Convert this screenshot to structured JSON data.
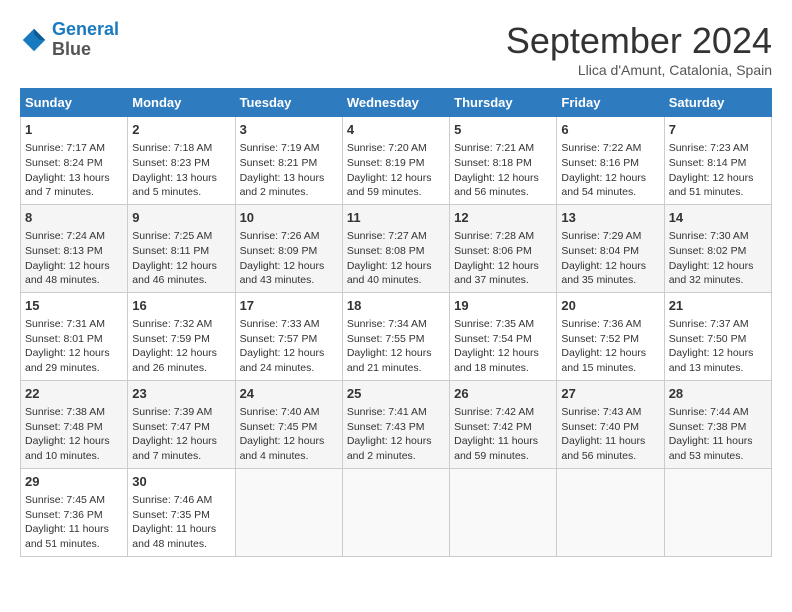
{
  "header": {
    "logo_line1": "General",
    "logo_line2": "Blue",
    "month": "September 2024",
    "location": "Llica d'Amunt, Catalonia, Spain"
  },
  "days_of_week": [
    "Sunday",
    "Monday",
    "Tuesday",
    "Wednesday",
    "Thursday",
    "Friday",
    "Saturday"
  ],
  "weeks": [
    [
      {
        "day": "1",
        "lines": [
          "Sunrise: 7:17 AM",
          "Sunset: 8:24 PM",
          "Daylight: 13 hours",
          "and 7 minutes."
        ]
      },
      {
        "day": "2",
        "lines": [
          "Sunrise: 7:18 AM",
          "Sunset: 8:23 PM",
          "Daylight: 13 hours",
          "and 5 minutes."
        ]
      },
      {
        "day": "3",
        "lines": [
          "Sunrise: 7:19 AM",
          "Sunset: 8:21 PM",
          "Daylight: 13 hours",
          "and 2 minutes."
        ]
      },
      {
        "day": "4",
        "lines": [
          "Sunrise: 7:20 AM",
          "Sunset: 8:19 PM",
          "Daylight: 12 hours",
          "and 59 minutes."
        ]
      },
      {
        "day": "5",
        "lines": [
          "Sunrise: 7:21 AM",
          "Sunset: 8:18 PM",
          "Daylight: 12 hours",
          "and 56 minutes."
        ]
      },
      {
        "day": "6",
        "lines": [
          "Sunrise: 7:22 AM",
          "Sunset: 8:16 PM",
          "Daylight: 12 hours",
          "and 54 minutes."
        ]
      },
      {
        "day": "7",
        "lines": [
          "Sunrise: 7:23 AM",
          "Sunset: 8:14 PM",
          "Daylight: 12 hours",
          "and 51 minutes."
        ]
      }
    ],
    [
      {
        "day": "8",
        "lines": [
          "Sunrise: 7:24 AM",
          "Sunset: 8:13 PM",
          "Daylight: 12 hours",
          "and 48 minutes."
        ]
      },
      {
        "day": "9",
        "lines": [
          "Sunrise: 7:25 AM",
          "Sunset: 8:11 PM",
          "Daylight: 12 hours",
          "and 46 minutes."
        ]
      },
      {
        "day": "10",
        "lines": [
          "Sunrise: 7:26 AM",
          "Sunset: 8:09 PM",
          "Daylight: 12 hours",
          "and 43 minutes."
        ]
      },
      {
        "day": "11",
        "lines": [
          "Sunrise: 7:27 AM",
          "Sunset: 8:08 PM",
          "Daylight: 12 hours",
          "and 40 minutes."
        ]
      },
      {
        "day": "12",
        "lines": [
          "Sunrise: 7:28 AM",
          "Sunset: 8:06 PM",
          "Daylight: 12 hours",
          "and 37 minutes."
        ]
      },
      {
        "day": "13",
        "lines": [
          "Sunrise: 7:29 AM",
          "Sunset: 8:04 PM",
          "Daylight: 12 hours",
          "and 35 minutes."
        ]
      },
      {
        "day": "14",
        "lines": [
          "Sunrise: 7:30 AM",
          "Sunset: 8:02 PM",
          "Daylight: 12 hours",
          "and 32 minutes."
        ]
      }
    ],
    [
      {
        "day": "15",
        "lines": [
          "Sunrise: 7:31 AM",
          "Sunset: 8:01 PM",
          "Daylight: 12 hours",
          "and 29 minutes."
        ]
      },
      {
        "day": "16",
        "lines": [
          "Sunrise: 7:32 AM",
          "Sunset: 7:59 PM",
          "Daylight: 12 hours",
          "and 26 minutes."
        ]
      },
      {
        "day": "17",
        "lines": [
          "Sunrise: 7:33 AM",
          "Sunset: 7:57 PM",
          "Daylight: 12 hours",
          "and 24 minutes."
        ]
      },
      {
        "day": "18",
        "lines": [
          "Sunrise: 7:34 AM",
          "Sunset: 7:55 PM",
          "Daylight: 12 hours",
          "and 21 minutes."
        ]
      },
      {
        "day": "19",
        "lines": [
          "Sunrise: 7:35 AM",
          "Sunset: 7:54 PM",
          "Daylight: 12 hours",
          "and 18 minutes."
        ]
      },
      {
        "day": "20",
        "lines": [
          "Sunrise: 7:36 AM",
          "Sunset: 7:52 PM",
          "Daylight: 12 hours",
          "and 15 minutes."
        ]
      },
      {
        "day": "21",
        "lines": [
          "Sunrise: 7:37 AM",
          "Sunset: 7:50 PM",
          "Daylight: 12 hours",
          "and 13 minutes."
        ]
      }
    ],
    [
      {
        "day": "22",
        "lines": [
          "Sunrise: 7:38 AM",
          "Sunset: 7:48 PM",
          "Daylight: 12 hours",
          "and 10 minutes."
        ]
      },
      {
        "day": "23",
        "lines": [
          "Sunrise: 7:39 AM",
          "Sunset: 7:47 PM",
          "Daylight: 12 hours",
          "and 7 minutes."
        ]
      },
      {
        "day": "24",
        "lines": [
          "Sunrise: 7:40 AM",
          "Sunset: 7:45 PM",
          "Daylight: 12 hours",
          "and 4 minutes."
        ]
      },
      {
        "day": "25",
        "lines": [
          "Sunrise: 7:41 AM",
          "Sunset: 7:43 PM",
          "Daylight: 12 hours",
          "and 2 minutes."
        ]
      },
      {
        "day": "26",
        "lines": [
          "Sunrise: 7:42 AM",
          "Sunset: 7:42 PM",
          "Daylight: 11 hours",
          "and 59 minutes."
        ]
      },
      {
        "day": "27",
        "lines": [
          "Sunrise: 7:43 AM",
          "Sunset: 7:40 PM",
          "Daylight: 11 hours",
          "and 56 minutes."
        ]
      },
      {
        "day": "28",
        "lines": [
          "Sunrise: 7:44 AM",
          "Sunset: 7:38 PM",
          "Daylight: 11 hours",
          "and 53 minutes."
        ]
      }
    ],
    [
      {
        "day": "29",
        "lines": [
          "Sunrise: 7:45 AM",
          "Sunset: 7:36 PM",
          "Daylight: 11 hours",
          "and 51 minutes."
        ]
      },
      {
        "day": "30",
        "lines": [
          "Sunrise: 7:46 AM",
          "Sunset: 7:35 PM",
          "Daylight: 11 hours",
          "and 48 minutes."
        ]
      },
      null,
      null,
      null,
      null,
      null
    ]
  ]
}
